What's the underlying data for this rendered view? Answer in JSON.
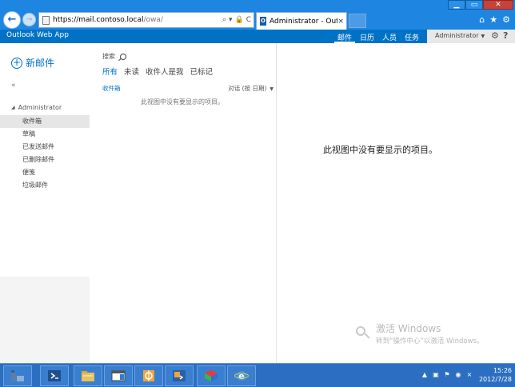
{
  "browser": {
    "window_controls": {
      "minimize": "▁",
      "maximize": "▭",
      "close": "✕"
    },
    "back_icon": "back-arrow-icon",
    "forward_icon": "forward-arrow-icon",
    "address": {
      "prefix": "https://mail.",
      "host": "contoso.local",
      "path": "/owa/"
    },
    "address_tools": {
      "search": "⌕",
      "dropdown": "▾",
      "lock": "🔒",
      "refresh": "C"
    },
    "tab": {
      "icon_text": "O",
      "title": "Administrator - Outlook ...",
      "close": "×"
    },
    "toolbar_icons": {
      "home": "⌂",
      "favorites": "★",
      "settings": "⚙"
    }
  },
  "owa": {
    "app_name": "Outlook Web App",
    "nav": [
      {
        "label": "邮件",
        "active": true
      },
      {
        "label": "日历",
        "active": false
      },
      {
        "label": "人员",
        "active": false
      },
      {
        "label": "任务",
        "active": false
      }
    ],
    "user": "Administrator",
    "user_caret": "▼",
    "gear": "⚙",
    "help": "?"
  },
  "sidebar": {
    "new_mail_icon": "+",
    "new_mail": "新邮件",
    "collapse": "«",
    "root_toggle": "◢",
    "root": "Administrator",
    "folders": [
      "收件箱",
      "草稿",
      "已发送邮件",
      "已删除邮件",
      "便笺",
      "垃圾邮件"
    ]
  },
  "list": {
    "search_label": "搜索",
    "filters": [
      "所有",
      "未读",
      "收件人是我",
      "已标记"
    ],
    "folder_title": "收件箱",
    "sort_label": "对话 (按 日期)",
    "sort_caret": "▼",
    "empty_message": "此视图中没有要显示的项目。"
  },
  "reading": {
    "empty_message": "此视图中没有要显示的项目。"
  },
  "watermark": {
    "line1": "激活 Windows",
    "line2": "转到“操作中心”以激活 Windows。"
  },
  "taskbar": {
    "tray": [
      "▲",
      "▣",
      "⚑",
      "◉",
      "×"
    ],
    "time": "15:26",
    "date": "2012/7/28"
  },
  "colors": {
    "owa_blue": "#0072c6",
    "chrome_blue": "#1e86e0",
    "taskbar": "#2c6fc2"
  }
}
